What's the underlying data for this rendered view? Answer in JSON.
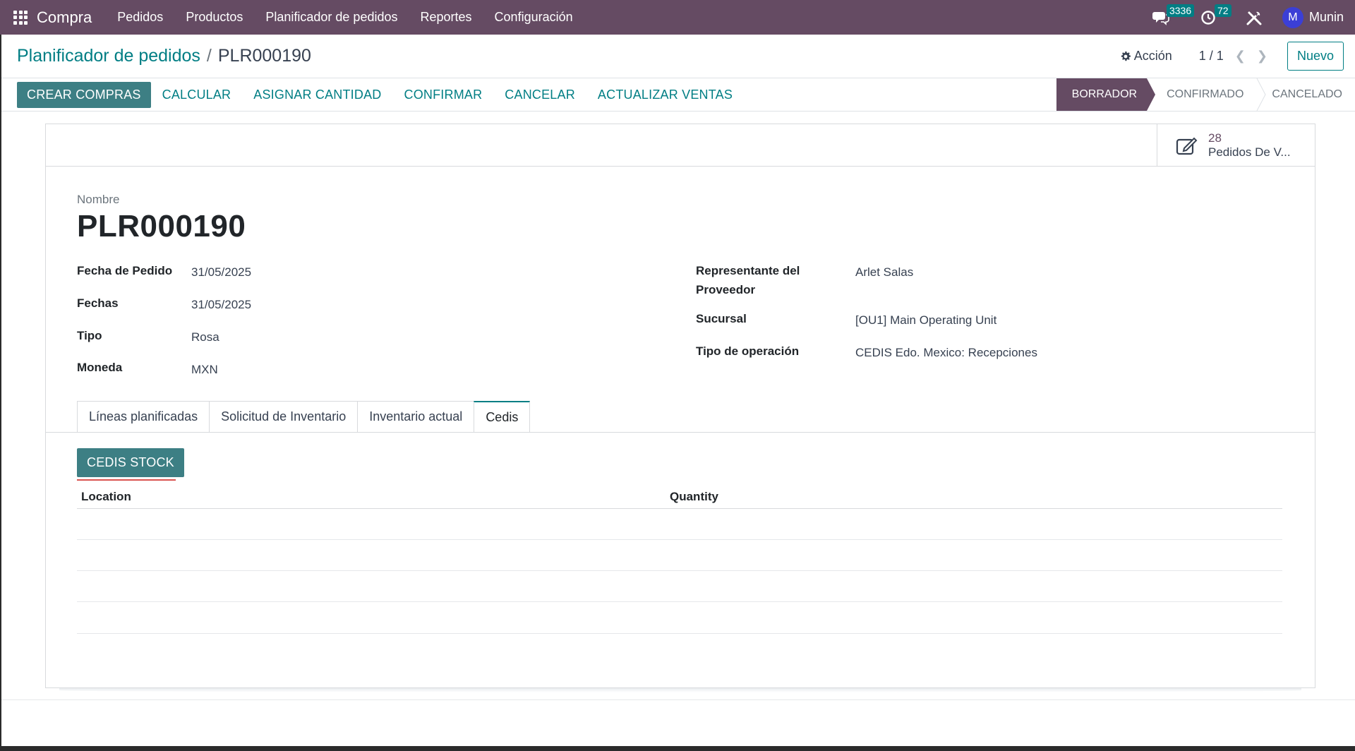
{
  "navbar": {
    "brand": "Compra",
    "menu": [
      "Pedidos",
      "Productos",
      "Planificador de pedidos",
      "Reportes",
      "Configuración"
    ],
    "messages_count": "3336",
    "activities_count": "72",
    "user_initial": "M",
    "user_name": "Munin",
    "color": "#654b63"
  },
  "breadcrumb": {
    "parent": "Planificador de pedidos",
    "separator": "/",
    "current": "PLR000190"
  },
  "control": {
    "action_label": "Acción",
    "pager": "1 / 1",
    "new_label": "Nuevo"
  },
  "buttons": {
    "primary": "CREAR COMPRAS",
    "secondary": [
      "CALCULAR",
      "ASIGNAR CANTIDAD",
      "CONFIRMAR",
      "CANCELAR",
      "ACTUALIZAR VENTAS"
    ]
  },
  "stages": {
    "active": "BORRADOR",
    "others": [
      "CONFIRMADO",
      "CANCELADO"
    ]
  },
  "smart_button": {
    "count": "28",
    "label": "Pedidos De V..."
  },
  "record": {
    "name_label": "Nombre",
    "name": "PLR000190"
  },
  "fields_left": [
    {
      "label": "Fecha de Pedido",
      "value": "31/05/2025"
    },
    {
      "label": "Fechas",
      "value": "31/05/2025"
    },
    {
      "label": "Tipo",
      "value": "Rosa"
    },
    {
      "label": "Moneda",
      "value": "MXN"
    }
  ],
  "fields_right": [
    {
      "label_line1": "Representante del",
      "label_line2": "Proveedor",
      "value": "Arlet Salas"
    },
    {
      "label": "Sucursal",
      "value": "[OU1] Main Operating Unit"
    },
    {
      "label": "Tipo de operación",
      "value": "CEDIS Edo. Mexico: Recepciones"
    }
  ],
  "tabs": [
    "Líneas planificadas",
    "Solicitud de Inventario",
    "Inventario actual",
    "Cedis"
  ],
  "active_tab": "Cedis",
  "cedis": {
    "button": "CEDIS STOCK",
    "columns": [
      "Location",
      "Quantity"
    ]
  }
}
